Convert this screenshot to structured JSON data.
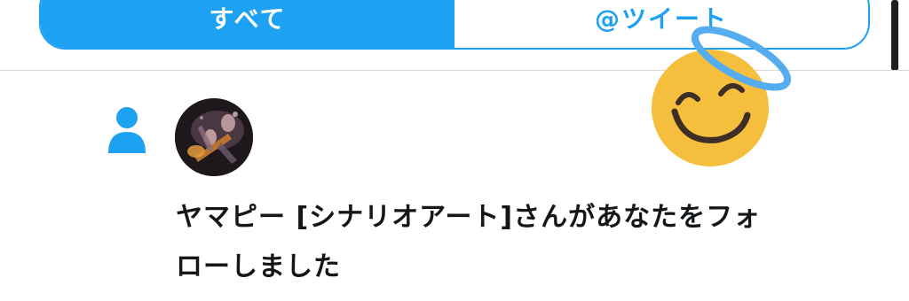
{
  "tabs": {
    "all_label": "すべて",
    "mentions_label": "@ツイート"
  },
  "notification": {
    "line1": "ヤマピー [シナリオアート]さんがあなたをフォ",
    "line2": "ローしました"
  },
  "icons": {
    "notification_type": "person-icon",
    "overlay": "smiling-face-with-halo-emoji"
  },
  "colors": {
    "accent": "#1da1f2",
    "text": "#14171a",
    "emoji_face": "#f5be3c",
    "halo": "#55acee"
  }
}
